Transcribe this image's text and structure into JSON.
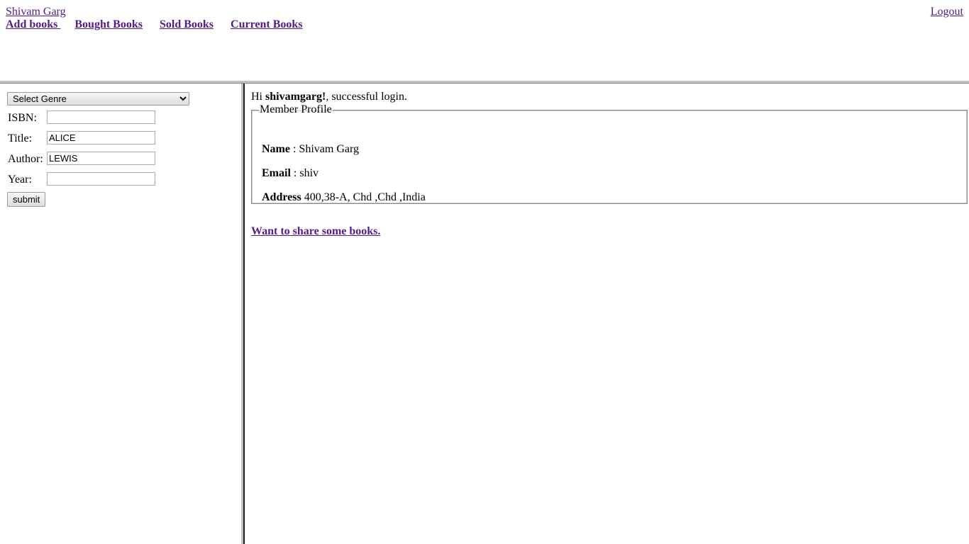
{
  "header": {
    "user": "Shivam Garg",
    "logout": "Logout",
    "nav": [
      "Add books ",
      "Bought Books",
      " Sold Books",
      "Current Books"
    ]
  },
  "search": {
    "genre": "Select Genre",
    "isbn_label": "ISBN:",
    "isbn": "",
    "title_label": "Title:",
    "title": "ALICE",
    "author_label": "Author:",
    "author": "LEWIS",
    "year_label": "Year:",
    "year": "",
    "submit": "submit"
  },
  "main": {
    "greeting_pre": "Hi ",
    "username": "shivamgarg!",
    "greeting_post": ", successful login.",
    "profile": {
      "legend": "Member Profile",
      "name_label": "Name",
      "name": " : Shivam Garg",
      "email_label": "Email",
      "email": " : shiv",
      "address_label": "Address",
      "address": " 400,38-A, Chd ,Chd ,India"
    },
    "share": "Want to share some books. "
  }
}
